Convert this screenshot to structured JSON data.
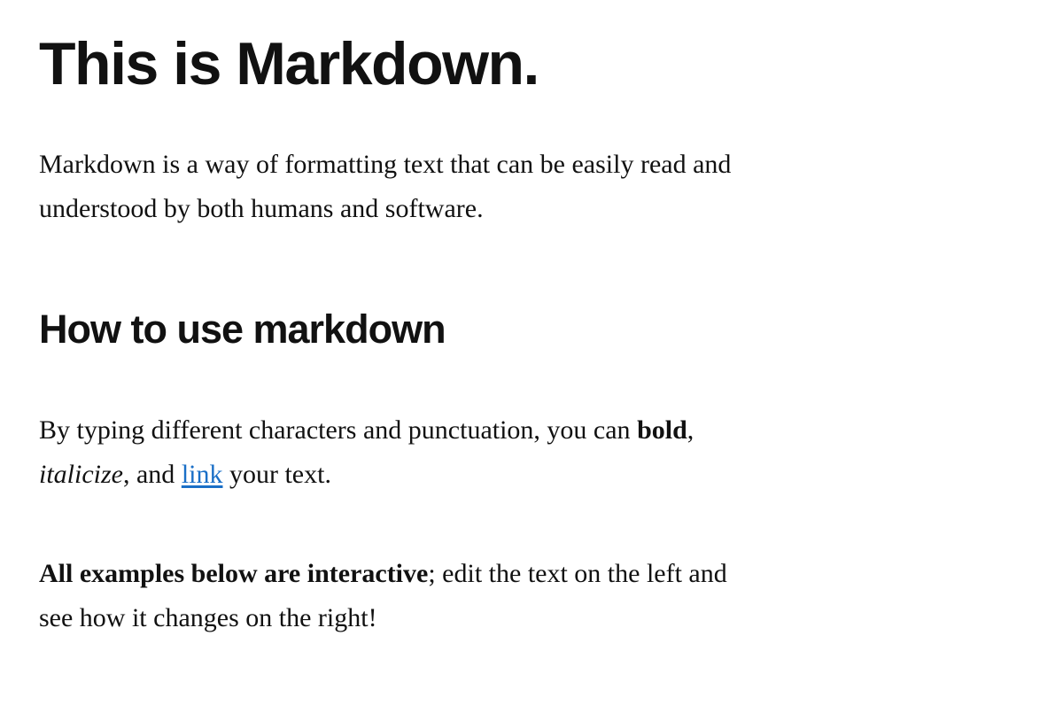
{
  "title": "This is Markdown.",
  "intro": {
    "line1": "Markdown is a way of formatting text that can be easily read and",
    "line2": "understood by both humans and software."
  },
  "section_heading": "How to use markdown",
  "usage": {
    "before_bold": "By typing different characters and punctuation, you can ",
    "bold_word": "bold",
    "after_bold": ",",
    "italic_word": "italicize",
    "between": ", and ",
    "link_text": "link",
    "after_link": " your text."
  },
  "interactive": {
    "bold_phrase": "All examples below are interactive",
    "rest_line1": "; edit the text on the left and",
    "line2": "see how it changes on the right!"
  },
  "colors": {
    "text": "#111111",
    "link": "#1a6fc7",
    "background": "#ffffff"
  }
}
